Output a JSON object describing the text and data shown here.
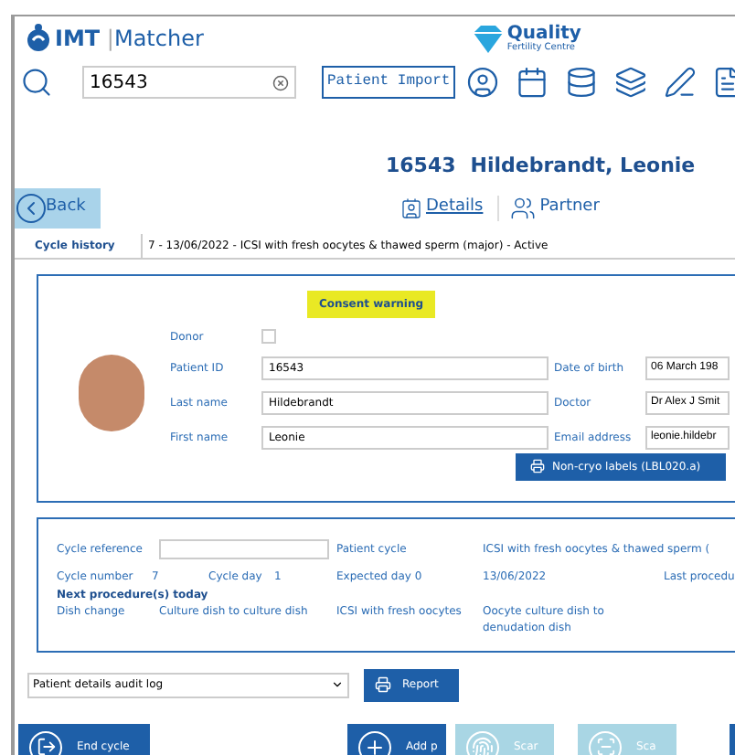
{
  "header": {
    "brand_bold": "IMT",
    "separator": "|",
    "brand": "Matcher",
    "partner_name": "Quality",
    "partner_sub": "Fertility Centre"
  },
  "search": {
    "value": "16543"
  },
  "import_button": "Patient Import",
  "patient_title": {
    "id": "16543",
    "name": "Hildebrandt, Leonie"
  },
  "back_button": "Back",
  "tabs": [
    {
      "label": "Details",
      "selected": true
    },
    {
      "label": "Partner",
      "selected": false
    }
  ],
  "cycle_history": {
    "label": "Cycle history",
    "value": "7 - 13/06/2022 - ICSI with fresh oocytes & thawed sperm (major) - Active"
  },
  "consent_warning": "Consent warning",
  "donor": {
    "label": "Donor",
    "checked": false
  },
  "fields_left": [
    {
      "label": "Patient ID",
      "value": "16543"
    },
    {
      "label": "Last name",
      "value": "Hildebrandt"
    },
    {
      "label": "First name",
      "value": "Leonie"
    }
  ],
  "fields_right": [
    {
      "label": "Date of birth",
      "value": "06 March 198"
    },
    {
      "label": "Doctor",
      "value": "Dr Alex J Smit"
    },
    {
      "label": "Email address",
      "value": "leonie.hildebr"
    }
  ],
  "labels_button": "Non-cryo labels (LBL020.a)",
  "cycle": {
    "reference_label": "Cycle reference",
    "patient_cycle_label": "Patient cycle",
    "patient_cycle_value": "ICSI with fresh oocytes & thawed sperm (",
    "number_label": "Cycle number",
    "number": "7",
    "day_label": "Cycle day",
    "day": "1",
    "expected_label": "Expected day 0",
    "expected_value": "13/06/2022",
    "last_label": "Last procedu",
    "next_heading": "Next procedure(s) today",
    "next": [
      "Dish change",
      "Culture dish to culture dish",
      "ICSI with fresh oocytes",
      "Oocyte culture dish to denudation dish"
    ]
  },
  "audit_select": {
    "value": "Patient details audit log"
  },
  "report_button": "Report",
  "actions": [
    {
      "label": "End cycle",
      "kind": "end",
      "disabled": false
    },
    {
      "label": "Add p",
      "kind": "add",
      "disabled": false
    },
    {
      "label": "Scar",
      "kind": "fingerprint",
      "disabled": true
    },
    {
      "label": "Sca",
      "kind": "scan",
      "disabled": true
    },
    {
      "kind": "blank",
      "disabled": false
    }
  ]
}
